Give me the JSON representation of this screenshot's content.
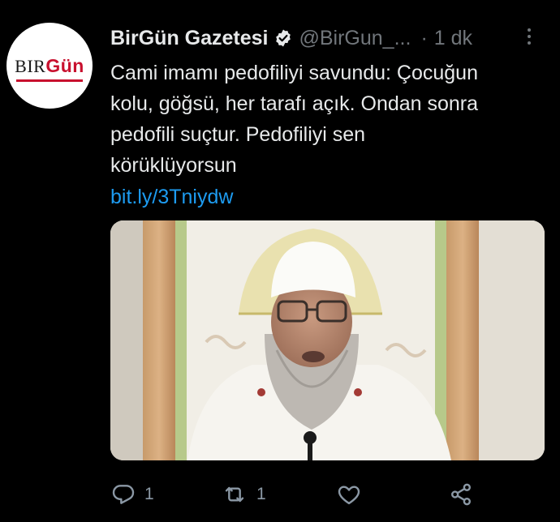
{
  "tweet": {
    "avatar": {
      "logo_text_left": "BIR",
      "logo_text_right": "Gün"
    },
    "author_name": "BirGün Gazetesi",
    "handle": "@BirGun_...",
    "separator": "·",
    "time": "1 dk",
    "text_lines": [
      "Cami imamı pedofiliyi savundu: Çocuğun",
      "kolu, göğsü, her tarafı açık. Ondan sonra",
      "pedofili suçtur. Pedofiliyi sen",
      "körüklüyorsun"
    ],
    "link": "bit.ly/3Tniydw",
    "media": {
      "icon": "video-thumbnail"
    },
    "actions": {
      "reply_count": "1",
      "retweet_count": "1",
      "like_count": "",
      "reply_icon": "reply-icon",
      "retweet_icon": "retweet-icon",
      "like_icon": "heart-icon",
      "share_icon": "share-icon"
    }
  },
  "colors": {
    "background": "#000000",
    "text": "#e7e9ea",
    "muted": "#71767b",
    "link": "#1d9bf0",
    "brand_red": "#c8102e"
  }
}
